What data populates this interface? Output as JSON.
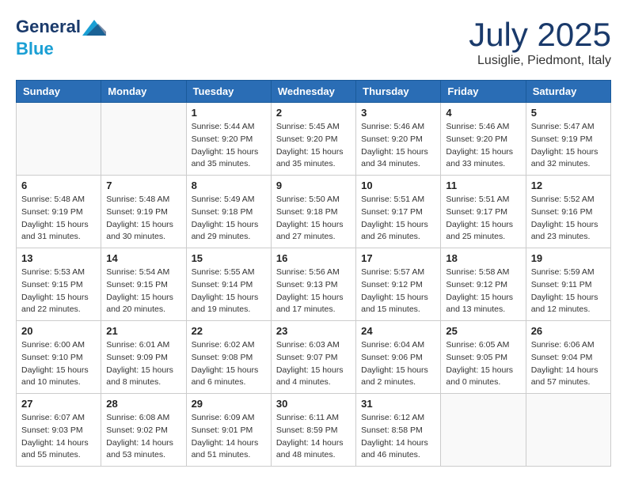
{
  "header": {
    "logo_line1": "General",
    "logo_line2": "Blue",
    "month": "July 2025",
    "location": "Lusiglie, Piedmont, Italy"
  },
  "weekdays": [
    "Sunday",
    "Monday",
    "Tuesday",
    "Wednesday",
    "Thursday",
    "Friday",
    "Saturday"
  ],
  "weeks": [
    [
      {
        "day": "",
        "info": ""
      },
      {
        "day": "",
        "info": ""
      },
      {
        "day": "1",
        "info": "Sunrise: 5:44 AM\nSunset: 9:20 PM\nDaylight: 15 hours\nand 35 minutes."
      },
      {
        "day": "2",
        "info": "Sunrise: 5:45 AM\nSunset: 9:20 PM\nDaylight: 15 hours\nand 35 minutes."
      },
      {
        "day": "3",
        "info": "Sunrise: 5:46 AM\nSunset: 9:20 PM\nDaylight: 15 hours\nand 34 minutes."
      },
      {
        "day": "4",
        "info": "Sunrise: 5:46 AM\nSunset: 9:20 PM\nDaylight: 15 hours\nand 33 minutes."
      },
      {
        "day": "5",
        "info": "Sunrise: 5:47 AM\nSunset: 9:19 PM\nDaylight: 15 hours\nand 32 minutes."
      }
    ],
    [
      {
        "day": "6",
        "info": "Sunrise: 5:48 AM\nSunset: 9:19 PM\nDaylight: 15 hours\nand 31 minutes."
      },
      {
        "day": "7",
        "info": "Sunrise: 5:48 AM\nSunset: 9:19 PM\nDaylight: 15 hours\nand 30 minutes."
      },
      {
        "day": "8",
        "info": "Sunrise: 5:49 AM\nSunset: 9:18 PM\nDaylight: 15 hours\nand 29 minutes."
      },
      {
        "day": "9",
        "info": "Sunrise: 5:50 AM\nSunset: 9:18 PM\nDaylight: 15 hours\nand 27 minutes."
      },
      {
        "day": "10",
        "info": "Sunrise: 5:51 AM\nSunset: 9:17 PM\nDaylight: 15 hours\nand 26 minutes."
      },
      {
        "day": "11",
        "info": "Sunrise: 5:51 AM\nSunset: 9:17 PM\nDaylight: 15 hours\nand 25 minutes."
      },
      {
        "day": "12",
        "info": "Sunrise: 5:52 AM\nSunset: 9:16 PM\nDaylight: 15 hours\nand 23 minutes."
      }
    ],
    [
      {
        "day": "13",
        "info": "Sunrise: 5:53 AM\nSunset: 9:15 PM\nDaylight: 15 hours\nand 22 minutes."
      },
      {
        "day": "14",
        "info": "Sunrise: 5:54 AM\nSunset: 9:15 PM\nDaylight: 15 hours\nand 20 minutes."
      },
      {
        "day": "15",
        "info": "Sunrise: 5:55 AM\nSunset: 9:14 PM\nDaylight: 15 hours\nand 19 minutes."
      },
      {
        "day": "16",
        "info": "Sunrise: 5:56 AM\nSunset: 9:13 PM\nDaylight: 15 hours\nand 17 minutes."
      },
      {
        "day": "17",
        "info": "Sunrise: 5:57 AM\nSunset: 9:12 PM\nDaylight: 15 hours\nand 15 minutes."
      },
      {
        "day": "18",
        "info": "Sunrise: 5:58 AM\nSunset: 9:12 PM\nDaylight: 15 hours\nand 13 minutes."
      },
      {
        "day": "19",
        "info": "Sunrise: 5:59 AM\nSunset: 9:11 PM\nDaylight: 15 hours\nand 12 minutes."
      }
    ],
    [
      {
        "day": "20",
        "info": "Sunrise: 6:00 AM\nSunset: 9:10 PM\nDaylight: 15 hours\nand 10 minutes."
      },
      {
        "day": "21",
        "info": "Sunrise: 6:01 AM\nSunset: 9:09 PM\nDaylight: 15 hours\nand 8 minutes."
      },
      {
        "day": "22",
        "info": "Sunrise: 6:02 AM\nSunset: 9:08 PM\nDaylight: 15 hours\nand 6 minutes."
      },
      {
        "day": "23",
        "info": "Sunrise: 6:03 AM\nSunset: 9:07 PM\nDaylight: 15 hours\nand 4 minutes."
      },
      {
        "day": "24",
        "info": "Sunrise: 6:04 AM\nSunset: 9:06 PM\nDaylight: 15 hours\nand 2 minutes."
      },
      {
        "day": "25",
        "info": "Sunrise: 6:05 AM\nSunset: 9:05 PM\nDaylight: 15 hours\nand 0 minutes."
      },
      {
        "day": "26",
        "info": "Sunrise: 6:06 AM\nSunset: 9:04 PM\nDaylight: 14 hours\nand 57 minutes."
      }
    ],
    [
      {
        "day": "27",
        "info": "Sunrise: 6:07 AM\nSunset: 9:03 PM\nDaylight: 14 hours\nand 55 minutes."
      },
      {
        "day": "28",
        "info": "Sunrise: 6:08 AM\nSunset: 9:02 PM\nDaylight: 14 hours\nand 53 minutes."
      },
      {
        "day": "29",
        "info": "Sunrise: 6:09 AM\nSunset: 9:01 PM\nDaylight: 14 hours\nand 51 minutes."
      },
      {
        "day": "30",
        "info": "Sunrise: 6:11 AM\nSunset: 8:59 PM\nDaylight: 14 hours\nand 48 minutes."
      },
      {
        "day": "31",
        "info": "Sunrise: 6:12 AM\nSunset: 8:58 PM\nDaylight: 14 hours\nand 46 minutes."
      },
      {
        "day": "",
        "info": ""
      },
      {
        "day": "",
        "info": ""
      }
    ]
  ]
}
